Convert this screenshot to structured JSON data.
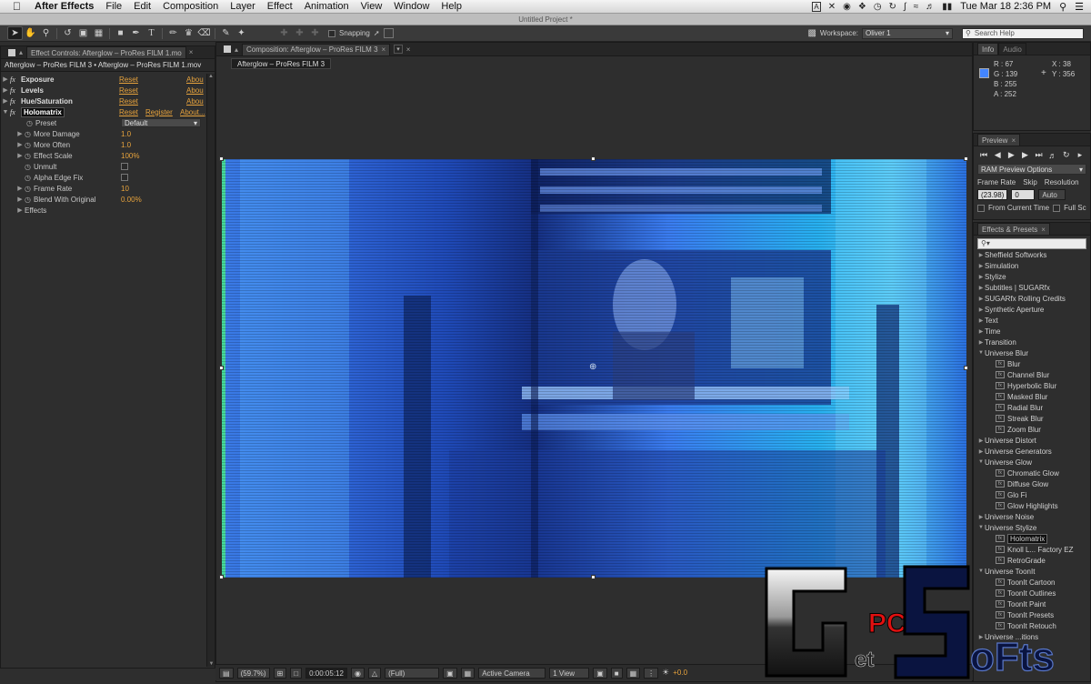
{
  "menubar": {
    "app": "After Effects",
    "items": [
      "File",
      "Edit",
      "Composition",
      "Layer",
      "Effect",
      "Animation",
      "View",
      "Window",
      "Help"
    ],
    "clock": "Tue Mar 18  2:36 PM",
    "tray_letter": "A"
  },
  "window": {
    "title": "Untitled Project *"
  },
  "toolbar": {
    "snapping_label": "Snapping",
    "workspace_label": "Workspace:",
    "workspace_value": "Oliver 1",
    "search_placeholder": "Search Help"
  },
  "effect_controls": {
    "tab_label": "Effect Controls: Afterglow – ProRes FILM 1.mo",
    "breadcrumb": "Afterglow – ProRes FILM 3 • Afterglow – ProRes FILM 1.mov",
    "effects": [
      {
        "name": "Exposure",
        "reset": "Reset",
        "about": "Abou"
      },
      {
        "name": "Levels",
        "reset": "Reset",
        "about": "Abou"
      },
      {
        "name": "Hue/Saturation",
        "reset": "Reset",
        "about": "Abou"
      }
    ],
    "holomatrix": {
      "name": "Holomatrix",
      "reset": "Reset",
      "register": "Register",
      "about": "About...",
      "preset_label": "Preset",
      "preset_value": "Default",
      "params": [
        {
          "label": "More Damage",
          "value": "1.0"
        },
        {
          "label": "More Often",
          "value": "1.0"
        },
        {
          "label": "Effect Scale",
          "value": "100%"
        },
        {
          "label": "Unmult",
          "value": ""
        },
        {
          "label": "Alpha Edge Fix",
          "value": ""
        },
        {
          "label": "Frame Rate",
          "value": "10"
        },
        {
          "label": "Blend With Original",
          "value": "0.00%"
        }
      ]
    },
    "effects_group": "Effects"
  },
  "composition": {
    "tab_label": "Composition: Afterglow – ProRes FILM 3",
    "subtab": "Afterglow – ProRes FILM 3"
  },
  "statusbar": {
    "zoom": "(59.7%)",
    "timecode": "0:00:05:12",
    "resolution": "(Full)",
    "camera": "Active Camera",
    "views": "1 View",
    "exposure": "+0.0"
  },
  "info": {
    "tab": "Info",
    "tab2": "Audio",
    "r": "R : 67",
    "g": "G : 139",
    "b": "B : 255",
    "a": "A : 252",
    "x": "X : 38",
    "y": "Y : 356",
    "swatch": "#4385ff"
  },
  "preview": {
    "tab": "Preview",
    "options": "RAM Preview Options",
    "frame_rate_label": "Frame Rate",
    "skip_label": "Skip",
    "resolution_label": "Resolution",
    "frame_rate": "(23.98)",
    "skip": "0",
    "resolution": "Auto",
    "from_current": "From Current Time",
    "full_screen": "Full Sc"
  },
  "effects_presets": {
    "tab": "Effects & Presets",
    "items": [
      {
        "label": "Sheffield Softworks",
        "type": "cat"
      },
      {
        "label": "Simulation",
        "type": "cat"
      },
      {
        "label": "Stylize",
        "type": "cat"
      },
      {
        "label": "Subtitles | SUGARfx",
        "type": "cat"
      },
      {
        "label": "SUGARfx Rolling Credits",
        "type": "cat"
      },
      {
        "label": "Synthetic Aperture",
        "type": "cat"
      },
      {
        "label": "Text",
        "type": "cat"
      },
      {
        "label": "Time",
        "type": "cat"
      },
      {
        "label": "Transition",
        "type": "cat"
      },
      {
        "label": "Universe Blur",
        "type": "open"
      },
      {
        "label": "Blur",
        "type": "fx"
      },
      {
        "label": "Channel Blur",
        "type": "fx"
      },
      {
        "label": "Hyperbolic Blur",
        "type": "fx"
      },
      {
        "label": "Masked Blur",
        "type": "fx"
      },
      {
        "label": "Radial Blur",
        "type": "fx"
      },
      {
        "label": "Streak Blur",
        "type": "fx"
      },
      {
        "label": "Zoom Blur",
        "type": "fx"
      },
      {
        "label": "Universe Distort",
        "type": "cat"
      },
      {
        "label": "Universe Generators",
        "type": "cat"
      },
      {
        "label": "Universe Glow",
        "type": "open"
      },
      {
        "label": "Chromatic Glow",
        "type": "fx"
      },
      {
        "label": "Diffuse Glow",
        "type": "fx"
      },
      {
        "label": "Glo Fi",
        "type": "fx"
      },
      {
        "label": "Glow Highlights",
        "type": "fx"
      },
      {
        "label": "Universe Noise",
        "type": "cat"
      },
      {
        "label": "Universe Stylize",
        "type": "open"
      },
      {
        "label": "Holomatrix",
        "type": "fx",
        "selected": true
      },
      {
        "label": "Knoll L... Factory EZ",
        "type": "fx"
      },
      {
        "label": "RetroGrade",
        "type": "fx"
      },
      {
        "label": "Universe ToonIt",
        "type": "open"
      },
      {
        "label": "ToonIt Cartoon",
        "type": "fx"
      },
      {
        "label": "ToonIt Outlines",
        "type": "fx"
      },
      {
        "label": "ToonIt Paint",
        "type": "fx"
      },
      {
        "label": "ToonIt Presets",
        "type": "fx"
      },
      {
        "label": "ToonIt Retouch",
        "type": "fx"
      },
      {
        "label": "Universe ...itions",
        "type": "cat"
      }
    ]
  },
  "watermark": {
    "letter_g": "G",
    "pc": "PC",
    "et": "et",
    "letter_s": "S",
    "rest": "oFts"
  }
}
